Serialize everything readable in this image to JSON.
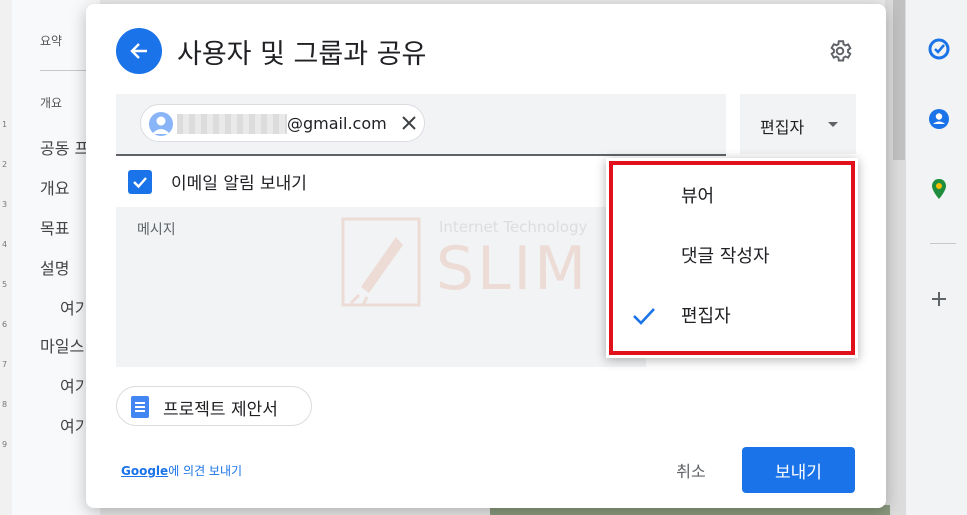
{
  "background": {
    "outline_items": [
      {
        "label": "요약",
        "size": "small"
      },
      {
        "label": "개요",
        "size": "small"
      },
      {
        "label": "공동 프",
        "size": "normal"
      },
      {
        "label": "개요",
        "size": "normal"
      },
      {
        "label": "목표",
        "size": "normal"
      },
      {
        "label": "설명",
        "size": "normal"
      },
      {
        "label": "여기",
        "size": "normal"
      },
      {
        "label": "마일스",
        "size": "normal"
      },
      {
        "label": "여기",
        "size": "normal"
      },
      {
        "label": "여기",
        "size": "normal"
      }
    ],
    "ruler_numbers": [
      "1",
      "2",
      "3",
      "4",
      "5",
      "6",
      "7",
      "8",
      "9"
    ],
    "side_icons": [
      "tasks-icon",
      "contacts-icon",
      "maps-icon",
      "add-icon"
    ]
  },
  "dialog": {
    "title": "사용자 및 그룹과 공유",
    "recipient": {
      "email_suffix": "@gmail.com"
    },
    "role_dropdown": {
      "selected": "편집자"
    },
    "notify": {
      "checked": true,
      "label": "이메일 알림 보내기"
    },
    "message": {
      "placeholder": "메시지"
    },
    "watermark": {
      "subtitle": "Internet Technology",
      "brand": "SLIM"
    },
    "document_chip": {
      "label": "프로젝트 제안서"
    },
    "feedback": {
      "brand": "Google",
      "text": "에 의견 보내기"
    },
    "buttons": {
      "cancel": "취소",
      "send": "보내기"
    }
  },
  "role_menu": {
    "options": [
      {
        "label": "뷰어",
        "selected": false
      },
      {
        "label": "댓글 작성자",
        "selected": false
      },
      {
        "label": "편집자",
        "selected": true
      }
    ]
  },
  "colors": {
    "accent": "#1a73e8",
    "highlight_border": "#e0111a"
  }
}
